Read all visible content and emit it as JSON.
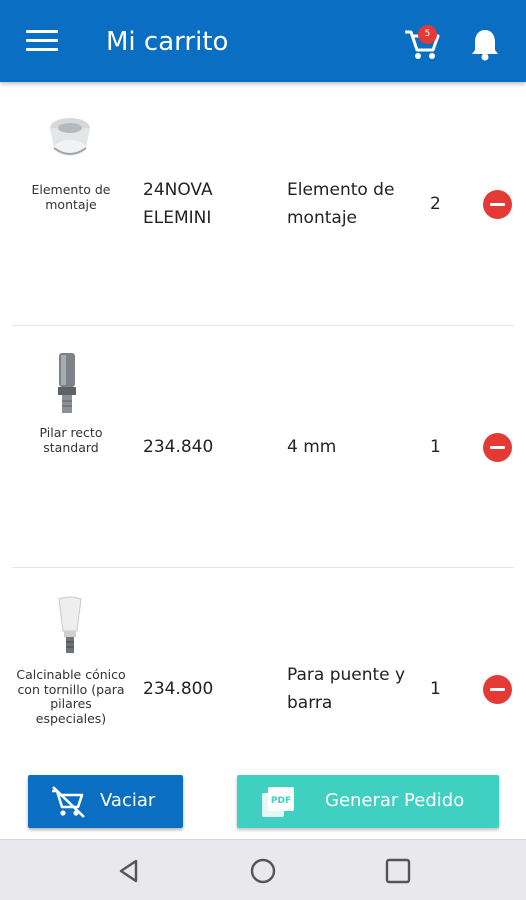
{
  "app": {
    "title": "Mi carrito",
    "cart_badge": "5",
    "accent_color": "#0a6fc2",
    "secondary_color": "#3fd0c1",
    "danger_color": "#e53935"
  },
  "items": [
    {
      "name": "Elemento de montaje",
      "code": "24NOVA ELEMINI",
      "description": "Elemento de montaje",
      "quantity": "2",
      "thumbnail_icon": "mounting-element-icon"
    },
    {
      "name": "Pilar recto standard",
      "code": "234.840",
      "description": "4 mm",
      "quantity": "1",
      "thumbnail_icon": "straight-abutment-icon"
    },
    {
      "name": "Calcinable cónico con tornillo (para pilares especiales)",
      "code": "234.800",
      "description": "Para puente y barra",
      "quantity": "1",
      "thumbnail_icon": "calcinable-icon"
    }
  ],
  "actions": {
    "empty_label": "Vaciar",
    "empty_icon": "remove-cart-icon",
    "generate_label": "Generar Pedido",
    "generate_icon": "pdf-icon"
  },
  "navbar": {
    "back_icon": "back-triangle-icon",
    "home_icon": "home-circle-icon",
    "recents_icon": "recents-square-icon"
  }
}
